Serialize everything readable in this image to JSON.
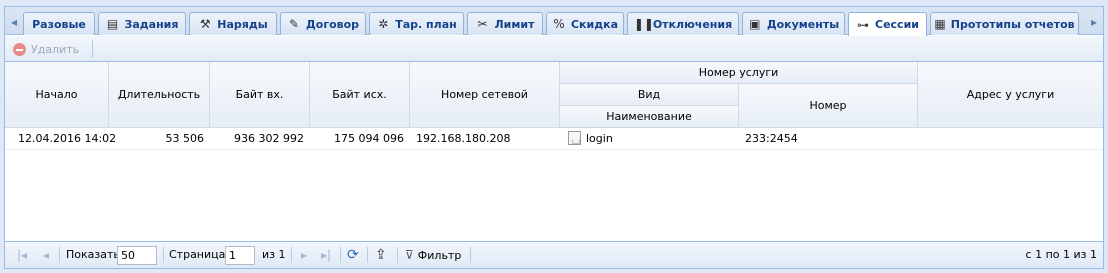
{
  "tabs": [
    {
      "label": "Разовые",
      "icon": "scroll-left-icon"
    },
    {
      "label": "Задания",
      "icon": "tasks-icon"
    },
    {
      "label": "Наряды",
      "icon": "wrench-icon"
    },
    {
      "label": "Договор",
      "icon": "contract-icon"
    },
    {
      "label": "Тар. план",
      "icon": "tariff-plan-icon"
    },
    {
      "label": "Лимит",
      "icon": "scissors-icon"
    },
    {
      "label": "Скидка",
      "icon": "discount-icon"
    },
    {
      "label": "Отключения",
      "icon": "pause-icon"
    },
    {
      "label": "Документы",
      "icon": "documents-icon"
    },
    {
      "label": "Сессии",
      "icon": "link-icon",
      "active": true
    },
    {
      "label": "Прототипы отчетов",
      "icon": "report-icon"
    }
  ],
  "toolbar": {
    "delete_label": "Удалить"
  },
  "grid": {
    "headers": {
      "start": "Начало",
      "duration": "Длительность",
      "bytes_in": "Байт вх.",
      "bytes_out": "Байт исх.",
      "network_number": "Номер сетевой",
      "service_number_group": "Номер услуги",
      "kind": "Вид",
      "name": "Наименование",
      "number": "Номер",
      "address": "Адрес у услуги"
    },
    "rows": [
      {
        "start": "12.04.2016 14:02",
        "duration": "53 506",
        "bytes_in": "936 302 992",
        "bytes_out": "175 094 096",
        "network_number": "192.168.180.208",
        "name": "login",
        "number": "233:2454",
        "address": ""
      }
    ]
  },
  "pager": {
    "show_label": "Показать",
    "page_size": "50",
    "page_label": "Страница",
    "page": "1",
    "of_label": "из 1",
    "filter_label": "Фильтр",
    "summary": "с 1 по 1 из 1"
  },
  "colors": {
    "accent": "#15428b",
    "border": "#99bbe8"
  }
}
